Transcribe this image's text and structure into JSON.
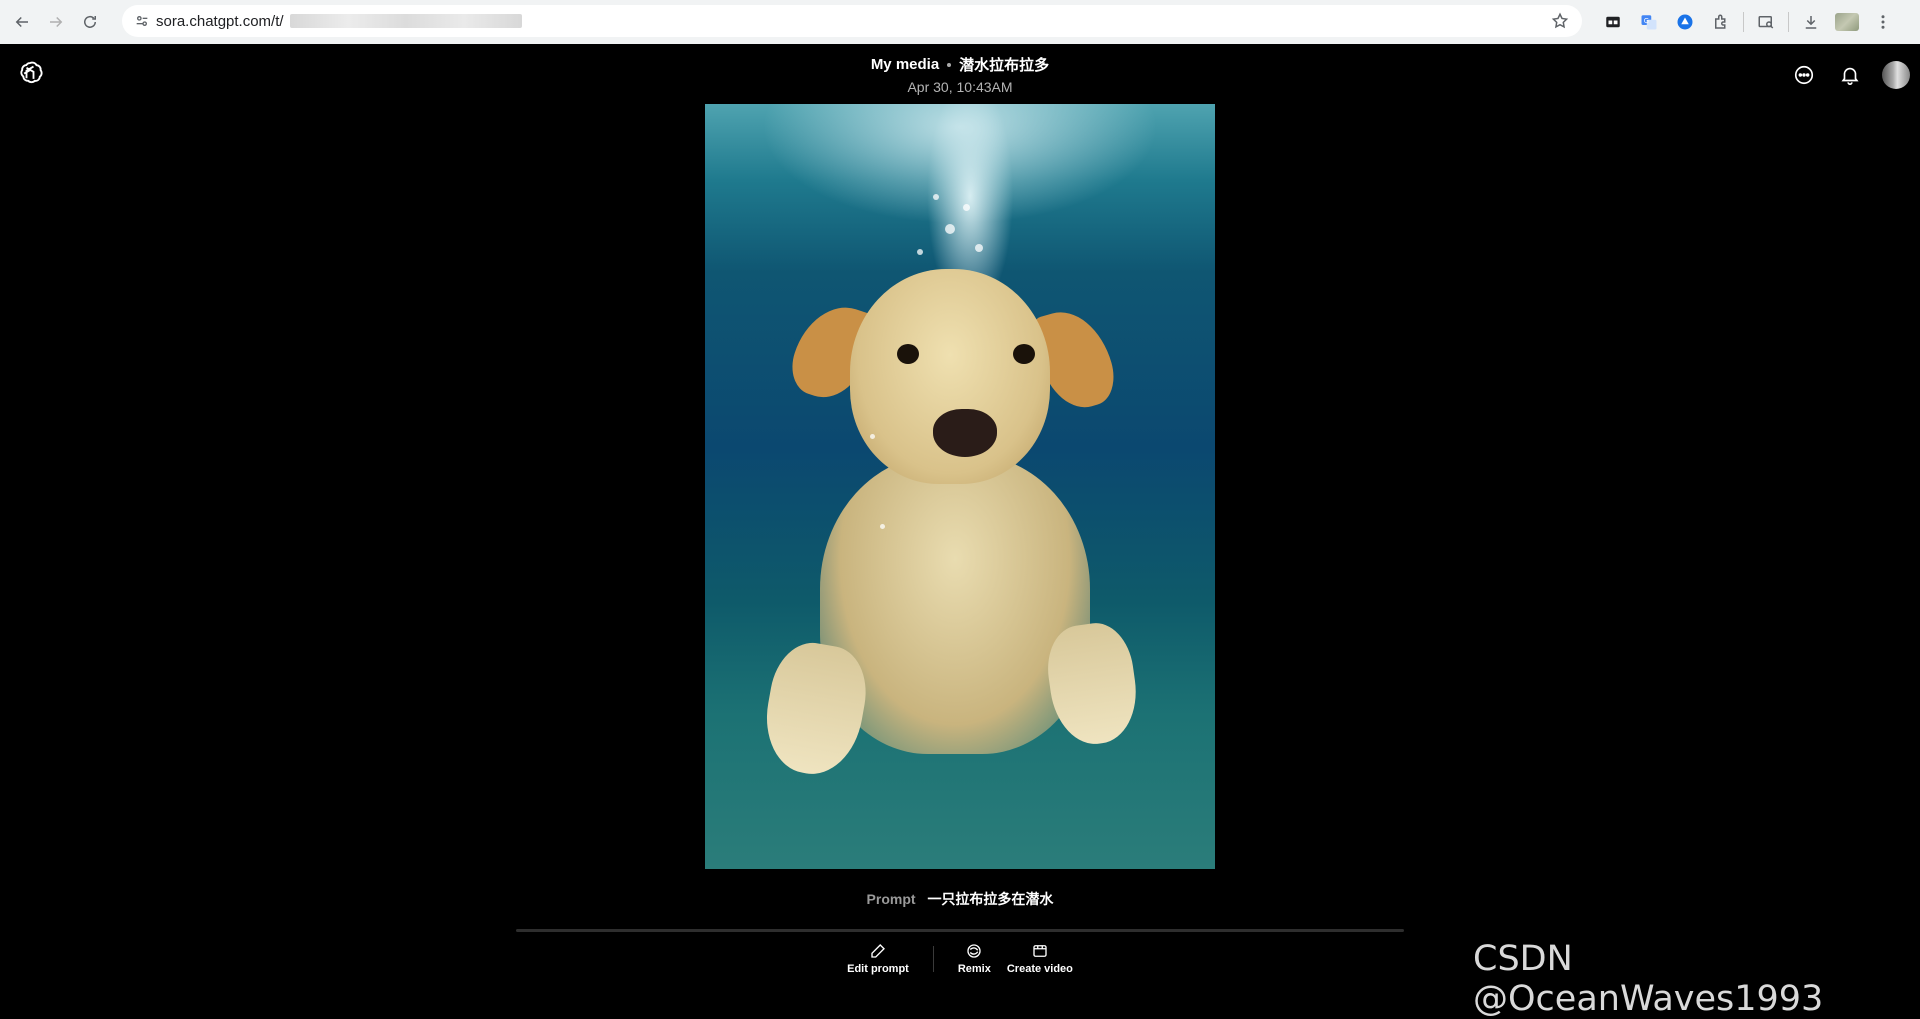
{
  "browser": {
    "url_visible": "sora.chatgpt.com/t/",
    "nav_icons": [
      "back-arrow-icon",
      "forward-arrow-icon",
      "reload-icon"
    ],
    "extension_icons": [
      "extension-grid-icon",
      "translate-icon",
      "drive-icon",
      "puzzle-icon",
      "tab-search-icon",
      "download-icon"
    ]
  },
  "header": {
    "title": "My media",
    "separator": "•",
    "subtitle": "潜水拉布拉多",
    "date": "Apr 30, 10:43AM"
  },
  "prompt": {
    "label": "Prompt",
    "text": "一只拉布拉多在潜水"
  },
  "actions": {
    "edit_prompt": "Edit prompt",
    "remix": "Remix",
    "create_video": "Create video"
  },
  "watermark": "CSDN @OceanWaves1993",
  "colors": {
    "page_bg": "#000000",
    "chrome_bg": "#f1f3f4",
    "prompt_label": "#9a9a9a"
  }
}
